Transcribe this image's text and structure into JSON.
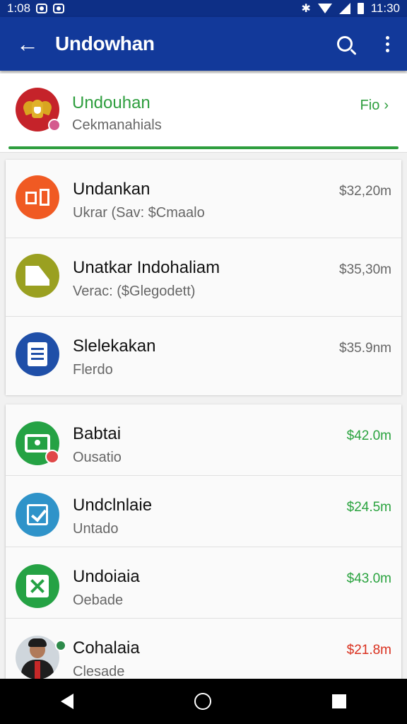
{
  "status_bar": {
    "time_left": "1:08",
    "time_right": "11:30"
  },
  "app_bar": {
    "title": "Undowhan"
  },
  "header": {
    "title": "Undouhan",
    "subtitle": "Cekmanahials",
    "link_label": "Fio",
    "accent_color": "#2e9e3e"
  },
  "list_groups": [
    {
      "items": [
        {
          "title": "Undankan",
          "subtitle": "Ukrar (Sav: $Cmaalo",
          "amount": "$32,20m",
          "icon": "store-icon",
          "color": "#f05a23",
          "amount_color": "gray"
        },
        {
          "title": "Unatkar Indohaliam",
          "subtitle": "Verac: ($Glegodett)",
          "amount": "$35,30m",
          "icon": "folder-icon",
          "color": "#9aa021",
          "amount_color": "gray"
        },
        {
          "title": "Slelekakan",
          "subtitle": "Flerdo",
          "amount": "$35.9nm",
          "icon": "document-icon",
          "color": "#1f4fa8",
          "amount_color": "gray"
        }
      ]
    },
    {
      "items": [
        {
          "title": "Babtai",
          "subtitle": "Ousatio",
          "amount": "$42.0m",
          "icon": "money-icon",
          "color": "#25a244",
          "amount_color": "green"
        },
        {
          "title": "Undclnlaie",
          "subtitle": "Untado",
          "amount": "$24.5m",
          "icon": "checkbox-icon",
          "color": "#2f93c9",
          "amount_color": "green"
        },
        {
          "title": "Undoiaia",
          "subtitle": "Oebade",
          "amount": "$43.0m",
          "icon": "check-square-icon",
          "color": "#25a244",
          "amount_color": "green"
        },
        {
          "title": "Cohalaia",
          "subtitle": "Clesade",
          "amount": "$21.8m",
          "icon": "avatar-photo",
          "color": "#cfd6dc",
          "amount_color": "red"
        }
      ]
    }
  ],
  "colors": {
    "app_bar": "#12399a",
    "status_bar": "#0d2f86",
    "green": "#2aa33f",
    "red": "#d9301e"
  }
}
